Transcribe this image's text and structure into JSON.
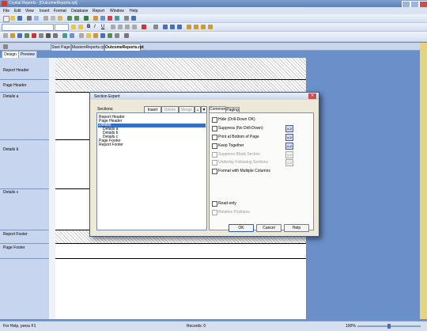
{
  "window": {
    "title": "Crystal Reports - [OutcomeReports.rpt]"
  },
  "menu": [
    "File",
    "Edit",
    "View",
    "Insert",
    "Format",
    "Database",
    "Report",
    "Window",
    "Help"
  ],
  "doc_tabs": [
    "Start Page",
    "MaxiomReports.rpt",
    "OutcomeReports.rpt"
  ],
  "view_tabs": [
    "Design",
    "Preview"
  ],
  "sections": [
    "Report Header",
    "Page Header",
    "Details a",
    "Details b",
    "Details c",
    "Report Footer",
    "Page Footer"
  ],
  "dialog": {
    "title": "Section Expert",
    "sections_label": "Sections:",
    "insert": "Insert",
    "delete": "Delete",
    "merge": "Merge",
    "up_arrow": "▲",
    "down_arrow": "▼",
    "list": [
      "Report Header",
      "Page Header",
      "Details",
      "Details a",
      "Details b",
      "Details c",
      "Page Footer",
      "Report Footer"
    ],
    "tabs": [
      "Common",
      "Paging"
    ],
    "options": [
      {
        "label": "Hide (Drill-Down OK)",
        "fx": false,
        "disabled": false
      },
      {
        "label": "Suppress (No Drill-Down)",
        "fx": true,
        "disabled": false
      },
      {
        "label": "Print at Bottom of Page",
        "fx": true,
        "disabled": false
      },
      {
        "label": "Keep Together",
        "fx": true,
        "disabled": false
      },
      {
        "label": "Suppress Blank Section",
        "fx": true,
        "disabled": true
      },
      {
        "label": "Underlay Following Sections",
        "fx": true,
        "disabled": true
      },
      {
        "label": "Format with Multiple Columns",
        "fx": false,
        "disabled": false
      }
    ],
    "readonly": "Read-only",
    "relative": "Relative Positions",
    "fx_label": "x-2",
    "ok": "OK",
    "cancel": "Cancel",
    "help": "Help"
  },
  "status": {
    "help": "For Help, press F1",
    "records": "Records: 0",
    "zoom": "100%"
  }
}
